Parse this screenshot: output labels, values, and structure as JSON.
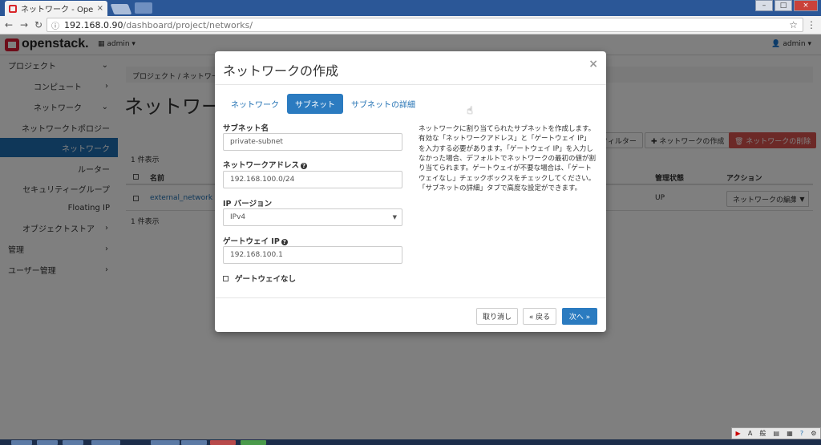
{
  "browser": {
    "tab_title": "ネットワーク - OpenSt",
    "tab_close": "×",
    "url_host": "192.168.0.90",
    "url_path": "/dashboard/project/networks/"
  },
  "header": {
    "logo": "openstack.",
    "project_selector": "admin ▾",
    "user_menu": "admin ▾"
  },
  "sidebar": {
    "items": [
      {
        "label": "プロジェクト",
        "chev": "⌄"
      },
      {
        "label": "コンピュート",
        "chev": "›"
      },
      {
        "label": "ネットワーク",
        "chev": "⌄"
      },
      {
        "label": "ネットワークトポロジー"
      },
      {
        "label": "ネットワーク"
      },
      {
        "label": "ルーター"
      },
      {
        "label": "セキュリティーグループ"
      },
      {
        "label": "Floating IP"
      },
      {
        "label": "オブジェクトストア",
        "chev": "›"
      },
      {
        "label": "管理",
        "chev": "›"
      },
      {
        "label": "ユーザー管理",
        "chev": "›"
      }
    ]
  },
  "main": {
    "breadcrumb": "プロジェクト / ネットワーク",
    "heading": "ネットワーク",
    "count_top": "1 件表示",
    "count_bottom": "1 件表示",
    "filter_button": "フィルター",
    "create_button": "✚ ネットワークの作成",
    "delete_button": "🗑 ネットワークの削除",
    "table": {
      "col_name": "名前",
      "col_admin_state": "管理状態",
      "col_actions": "アクション",
      "row": {
        "name": "external_network",
        "admin_state": "UP",
        "action": "ネットワークの編集"
      }
    }
  },
  "modal": {
    "title": "ネットワークの作成",
    "close": "×",
    "tabs": [
      "ネットワーク",
      "サブネット",
      "サブネットの詳細"
    ],
    "active_tab": "サブネット",
    "fields": {
      "subnet_name_label": "サブネット名",
      "subnet_name_value": "private-subnet",
      "network_address_label": "ネットワークアドレス",
      "network_address_value": "192.168.100.0/24",
      "ip_version_label": "IP バージョン",
      "ip_version_value": "IPv4",
      "gateway_ip_label": "ゲートウェイ IP",
      "gateway_ip_value": "192.168.100.1",
      "no_gateway_label": "ゲートウェイなし"
    },
    "help_text": "ネットワークに割り当てられたサブネットを作成します。有効な「ネットワークアドレス」と「ゲートウェイ IP」を入力する必要があります。「ゲートウェイ IP」を入力しなかった場合、デフォルトでネットワークの最初の値が割り当てられます。ゲートウェイが不要な場合は、「ゲートウェイなし」チェックボックスをチェックしてください。「サブネットの詳細」タブで高度な設定ができます。",
    "buttons": {
      "cancel": "取り消し",
      "back": "« 戻る",
      "next": "次へ »"
    }
  },
  "colors": {
    "accent": "#2b7bc0",
    "brand_red": "#da1a32",
    "danger": "#d9534f"
  }
}
